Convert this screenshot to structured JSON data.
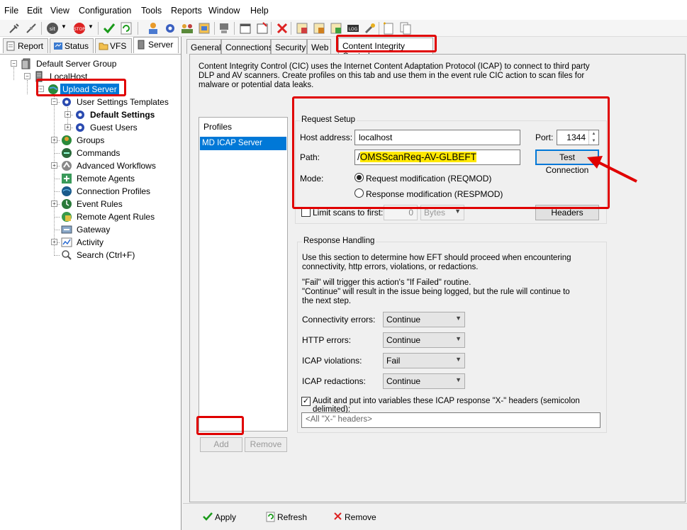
{
  "menu": [
    "File",
    "Edit",
    "View",
    "Configuration",
    "Tools",
    "Reports",
    "Window",
    "Help"
  ],
  "left_tabs": [
    "Report",
    "Status",
    "VFS",
    "Server"
  ],
  "tree": {
    "root": "Default Server Group",
    "host": "LocalHost",
    "selected_site": "Upload Server",
    "items": [
      "User Settings Templates",
      "Default Settings",
      "Guest Users",
      "Groups",
      "Commands",
      "Advanced Workflows",
      "Remote Agents",
      "Connection Profiles",
      "Event Rules",
      "Remote Agent Rules",
      "Gateway",
      "Activity",
      "Search (Ctrl+F)"
    ]
  },
  "right_tabs": [
    "General",
    "Connections",
    "Security",
    "Web",
    "Content Integrity Control"
  ],
  "description": "Content Integrity Control (CIC) uses the Internet Content Adaptation Protocol (ICAP) to connect to third party DLP and AV scanners. Create profiles on this tab and use them in the event rule CIC action to scan files for malware or potential data leaks.",
  "profiles": {
    "header": "Profiles",
    "items": [
      "MD ICAP Server"
    ],
    "add_label": "Add",
    "remove_label": "Remove"
  },
  "request_setup": {
    "title": "Request Setup",
    "host_label": "Host address:",
    "host_value": "localhost",
    "port_label": "Port:",
    "port_value": "1344",
    "path_label": "Path:",
    "path_slash": "/",
    "path_value": "OMSScanReq-AV-GLBEFT",
    "test_button": "Test Connection",
    "mode_label": "Mode:",
    "mode_reqmod": "Request modification (REQMOD)",
    "mode_respmod": "Response modification (RESPMOD)",
    "limit_label": "Limit scans to first:",
    "limit_value": "0",
    "limit_unit": "Bytes",
    "headers_button": "Headers"
  },
  "response_handling": {
    "title": "Response Handling",
    "desc1": "Use this section to determine how EFT should proceed when encountering connectivity, http errors, violations, or redactions.",
    "desc2": "\"Fail\" will trigger this action's \"If Failed\" routine.",
    "desc3": "\"Continue\" will result in the issue being logged, but the rule will continue to the next step.",
    "rows": [
      {
        "label": "Connectivity errors:",
        "value": "Continue"
      },
      {
        "label": "HTTP errors:",
        "value": "Continue"
      },
      {
        "label": "ICAP violations:",
        "value": "Fail"
      },
      {
        "label": "ICAP redactions:",
        "value": "Continue"
      }
    ],
    "audit_label": "Audit and put into variables these ICAP response \"X-\" headers (semicolon delimited):",
    "audit_value": "<All \"X-\" headers>"
  },
  "bottom": {
    "apply": "Apply",
    "refresh": "Refresh",
    "remove": "Remove"
  },
  "colors": {
    "highlight_red": "#e00000",
    "selection_blue": "#0078d7",
    "path_highlight": "#ffe800"
  }
}
